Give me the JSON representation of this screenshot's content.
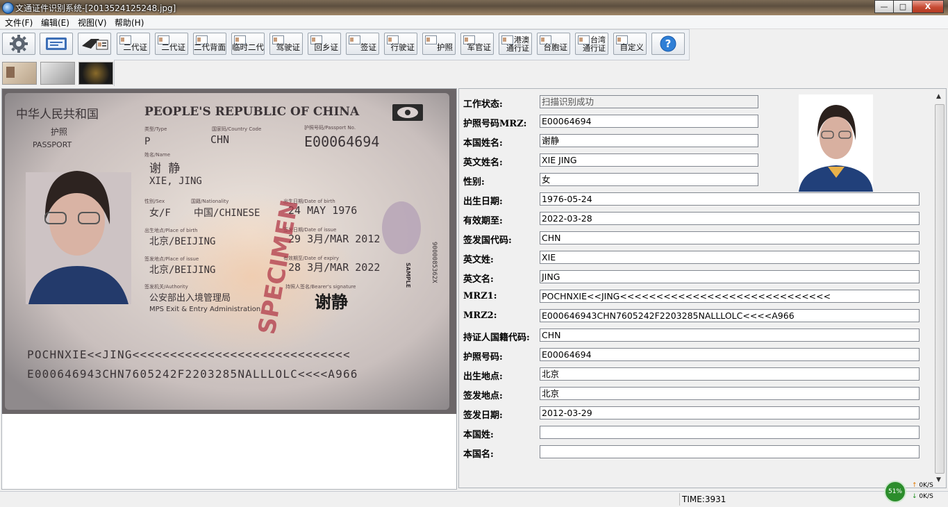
{
  "window": {
    "title": "文通证件识别系统-[2013524125248.jpg]",
    "minimize": "—",
    "maximize": "□",
    "close": "X"
  },
  "menu": [
    {
      "label": "文件(F)"
    },
    {
      "label": "编辑(E)"
    },
    {
      "label": "视图(V)"
    },
    {
      "label": "帮助(H)"
    }
  ],
  "toolbar": {
    "buttons": [
      {
        "id": "settings",
        "label": "",
        "icon": "gear-icon"
      },
      {
        "id": "scan",
        "label": "",
        "icon": "scanner-icon"
      },
      {
        "id": "card-reader",
        "label": "",
        "icon": "card-reader-icon"
      },
      {
        "id": "id2",
        "label": "二代证"
      },
      {
        "id": "id2b",
        "label": "二代证"
      },
      {
        "id": "id2back",
        "label": "二代背面"
      },
      {
        "id": "id2temp",
        "label": "临时二代"
      },
      {
        "id": "driver",
        "label": "驾驶证"
      },
      {
        "id": "homereturn",
        "label": "回乡证"
      },
      {
        "id": "visa",
        "label": "签证"
      },
      {
        "id": "vehicle",
        "label": "行驶证"
      },
      {
        "id": "passport",
        "label": "护照"
      },
      {
        "id": "officer",
        "label": "军官证"
      },
      {
        "id": "hkmacau",
        "label": "港澳",
        "label2": "通行证"
      },
      {
        "id": "taiwancompat",
        "label": "台胞证"
      },
      {
        "id": "taiwanpass",
        "label": "台湾",
        "label2": "通行证"
      },
      {
        "id": "custom",
        "label": "自定义"
      },
      {
        "id": "help",
        "label": "",
        "icon": "help-icon"
      }
    ]
  },
  "passport_scan": {
    "header_cn": "中华人民共和国",
    "header_en": "PEOPLE'S REPUBLIC OF CHINA",
    "passport_cn": "护照",
    "passport_en": "PASSPORT",
    "type_label": "类型/Type",
    "type": "P",
    "country_code_label": "国家码/Country Code",
    "country_code": "CHN",
    "passport_no_label": "护照号码/Passport No.",
    "passport_no": "E00064694",
    "name_label": "姓名/Name",
    "name_cn": "谢 静",
    "name_en": "XIE, JING",
    "sex_label": "性别/Sex",
    "sex": "女/F",
    "nationality_label": "国籍/Nationality",
    "nationality": "中国/CHINESE",
    "dob_label": "出生日期/Date of birth",
    "dob": "24 MAY 1976",
    "pob_label": "出生地点/Place of birth",
    "pob": "北京/BEIJING",
    "doi_label": "签发日期/Date of issue",
    "doi": "29 3月/MAR 2012",
    "poi_label": "签发地点/Place of issue",
    "poi": "北京/BEIJING",
    "doe_label": "有效期至/Date of expiry",
    "doe": "28 3月/MAR 2022",
    "authority_label": "签发机关/Authority",
    "authority_cn": "公安部出入境管理局",
    "authority_en": "MPS Exit & Entry Administration",
    "signature_label": "持照人签名/Bearer's signature",
    "signature": "谢静",
    "specimen": "SPECIMEN",
    "sample": "SAMPLE",
    "side_no": "9000085362X",
    "mrz1": "POCHNXIE<<JING<<<<<<<<<<<<<<<<<<<<<<<<<<<<<",
    "mrz2": "E000646943CHN7605242F2203285NALLLOLC<<<<A966"
  },
  "fields": [
    {
      "label": "工作状态:",
      "value": "扫描识别成功",
      "width": "short",
      "status": true
    },
    {
      "label": "护照号码MRZ:",
      "value": "E00064694",
      "width": "short"
    },
    {
      "label": "本国姓名:",
      "value": "谢静",
      "width": "short"
    },
    {
      "label": "英文姓名:",
      "value": "XIE  JING",
      "width": "short"
    },
    {
      "label": "性别:",
      "value": "女",
      "width": "short"
    },
    {
      "label": "出生日期:",
      "value": "1976-05-24",
      "width": "long"
    },
    {
      "label": "有效期至:",
      "value": "2022-03-28",
      "width": "long"
    },
    {
      "label": "签发国代码:",
      "value": "CHN",
      "width": "long"
    },
    {
      "label": "英文姓:",
      "value": "XIE",
      "width": "long"
    },
    {
      "label": "英文名:",
      "value": "JING",
      "width": "long"
    },
    {
      "label": "MRZ1:",
      "value": "POCHNXIE<<JING<<<<<<<<<<<<<<<<<<<<<<<<<<<<<",
      "width": "long"
    },
    {
      "label": "MRZ2:",
      "value": "E000646943CHN7605242F2203285NALLLOLC<<<<A966",
      "width": "long"
    },
    {
      "label": "持证人国籍代码:",
      "value": "CHN",
      "width": "long"
    },
    {
      "label": "护照号码:",
      "value": "E00064694",
      "width": "long"
    },
    {
      "label": "出生地点:",
      "value": "北京",
      "width": "long"
    },
    {
      "label": "签发地点:",
      "value": "北京",
      "width": "long"
    },
    {
      "label": "签发日期:",
      "value": "2012-03-29",
      "width": "long"
    },
    {
      "label": "本国姓:",
      "value": "",
      "width": "long"
    },
    {
      "label": "本国名:",
      "value": "",
      "width": "long"
    }
  ],
  "status": {
    "time": "TIME:3931",
    "net_percent": "51%",
    "upload": "0K/S",
    "download": "0K/S"
  }
}
